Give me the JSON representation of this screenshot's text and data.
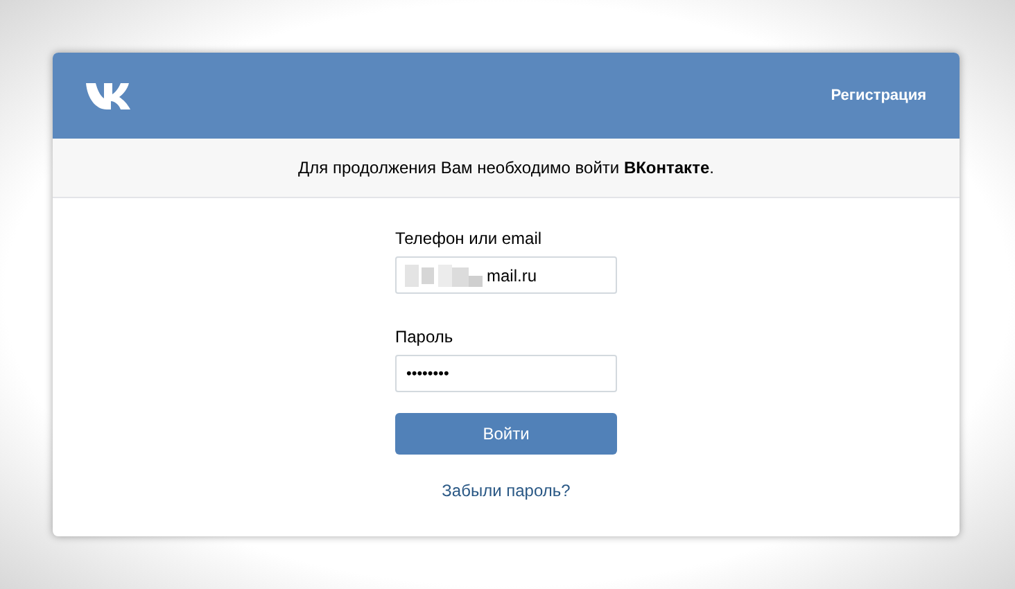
{
  "header": {
    "register_link": "Регистрация"
  },
  "notice": {
    "text": "Для продолжения Вам необходимо войти **ВКонтакте**."
  },
  "form": {
    "login_label": "Телефон или email",
    "login_value": "mail.ru",
    "login_redacted": true,
    "password_label": "Пароль",
    "password_value": "••••••••",
    "submit": "Войти",
    "forgot_link": "Забыли пароль?"
  }
}
